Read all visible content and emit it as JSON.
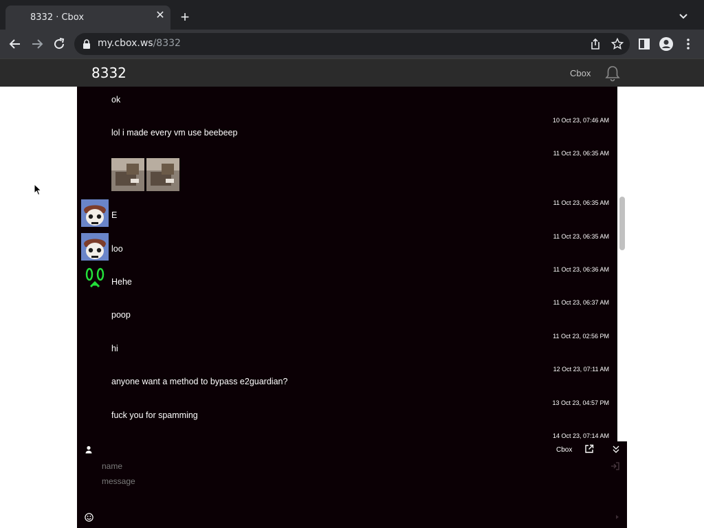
{
  "browser": {
    "tab_title": "8332 · Cbox",
    "url_host": "my.cbox.ws",
    "url_path": "/8332",
    "icons": [
      "close-icon",
      "plus-icon",
      "chevron-down-icon",
      "back-arrow-icon",
      "forward-arrow-icon",
      "reload-icon",
      "lock-icon",
      "share-icon",
      "star-icon",
      "side-panel-icon",
      "profile-icon",
      "kebab-menu-icon"
    ]
  },
  "site": {
    "title": "8332",
    "cbox_label": "Cbox",
    "icons": [
      "bell-icon"
    ]
  },
  "messages": [
    {
      "author": "",
      "time": "",
      "text": "ok"
    },
    {
      "author": "",
      "time": "10 Oct 23, 07:46 AM",
      "text": "lol i made every vm use beebeep"
    },
    {
      "author": "",
      "time": "11 Oct 23, 06:35 AM",
      "text": "",
      "images": 2
    },
    {
      "author": "",
      "time": "11 Oct 23, 06:35 AM",
      "text": "E",
      "avatar": "skull-girl-avatar"
    },
    {
      "author": "",
      "time": "11 Oct 23, 06:35 AM",
      "text": "loo",
      "avatar": "skull-girl-avatar"
    },
    {
      "author": "",
      "time": "11 Oct 23, 06:36 AM",
      "text": "Hehe",
      "avatar": "green-face-avatar"
    },
    {
      "author": "",
      "time": "11 Oct 23, 06:37 AM",
      "text": "poop"
    },
    {
      "author": "",
      "time": "11 Oct 23, 02:56 PM",
      "text": "hi"
    },
    {
      "author": "",
      "time": "12 Oct 23, 07:11 AM",
      "text": "anyone want a method to bypass e2guardian?"
    },
    {
      "author": "",
      "time": "13 Oct 23, 04:57 PM",
      "text": "fuck you for spamming"
    },
    {
      "author": "",
      "time": "14 Oct 23, 07:14 AM",
      "text": ""
    }
  ],
  "input": {
    "cbox_label": "Cbox",
    "name_placeholder": "name",
    "message_placeholder": "message",
    "icons": [
      "user-icon",
      "popout-icon",
      "collapse-icon",
      "login-icon",
      "emoji-icon",
      "send-icon"
    ]
  },
  "colors": {
    "panel_bg": "#0b0005",
    "author_link": "#1010c8",
    "header_bg": "#2b2b2b",
    "chrome_dark": "#202124"
  }
}
